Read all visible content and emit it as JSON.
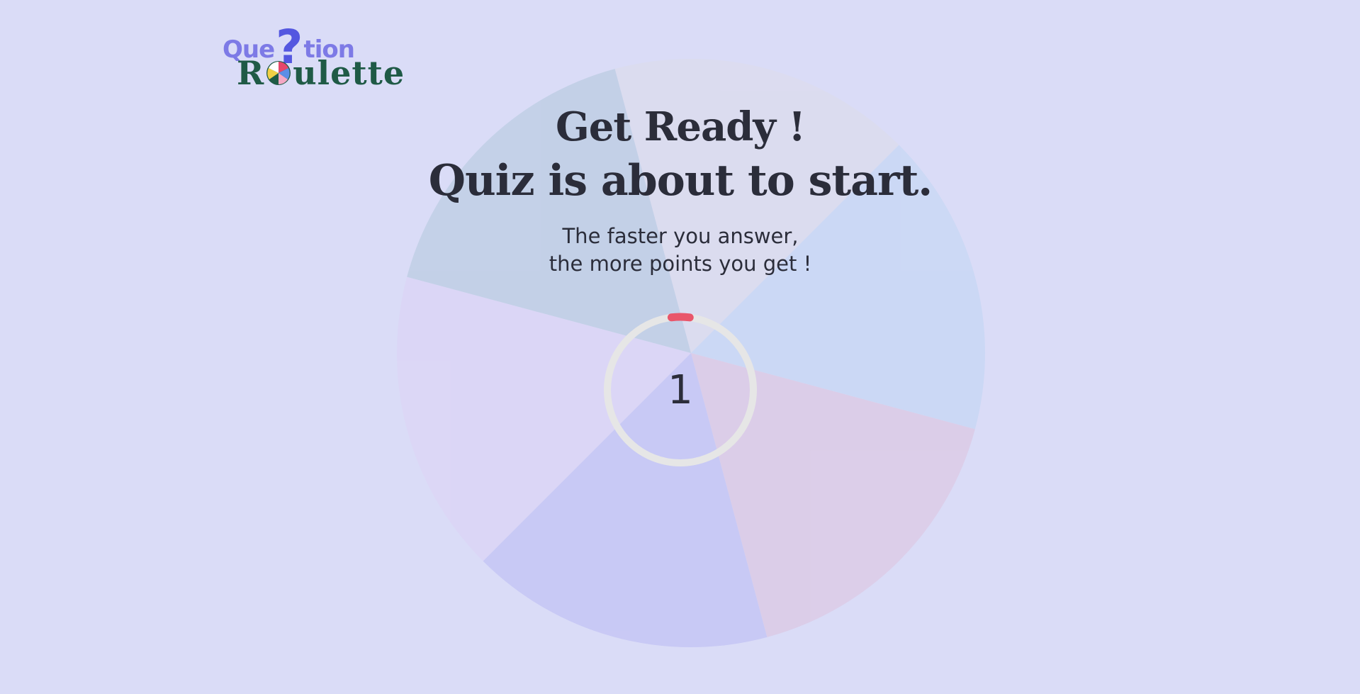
{
  "logo": {
    "line1_prefix": "Que",
    "line1_mark": "?",
    "line1_suffix": "tion",
    "line2_first": "R",
    "line2_rest": "ulette"
  },
  "heading": {
    "line1": "Get Ready !",
    "line2": "Quiz is about to start."
  },
  "subtitle": {
    "line1": "The faster you answer,",
    "line2": "the more points you get !"
  },
  "countdown": {
    "value": "1",
    "progress_fraction": 0.04,
    "ring_color": "#e6e6e6",
    "progress_color": "#e9566a"
  },
  "wheel": {
    "segment_colors": [
      "#dcdcee",
      "#c9d8f5",
      "#dccbe6",
      "#c6c6f5",
      "#dcd6f6",
      "#c0cfe5"
    ]
  },
  "colors": {
    "background": "#dadcf7",
    "text": "#2b2d3a",
    "logo_purple": "#7d7ae6",
    "logo_green": "#1f5a46"
  }
}
